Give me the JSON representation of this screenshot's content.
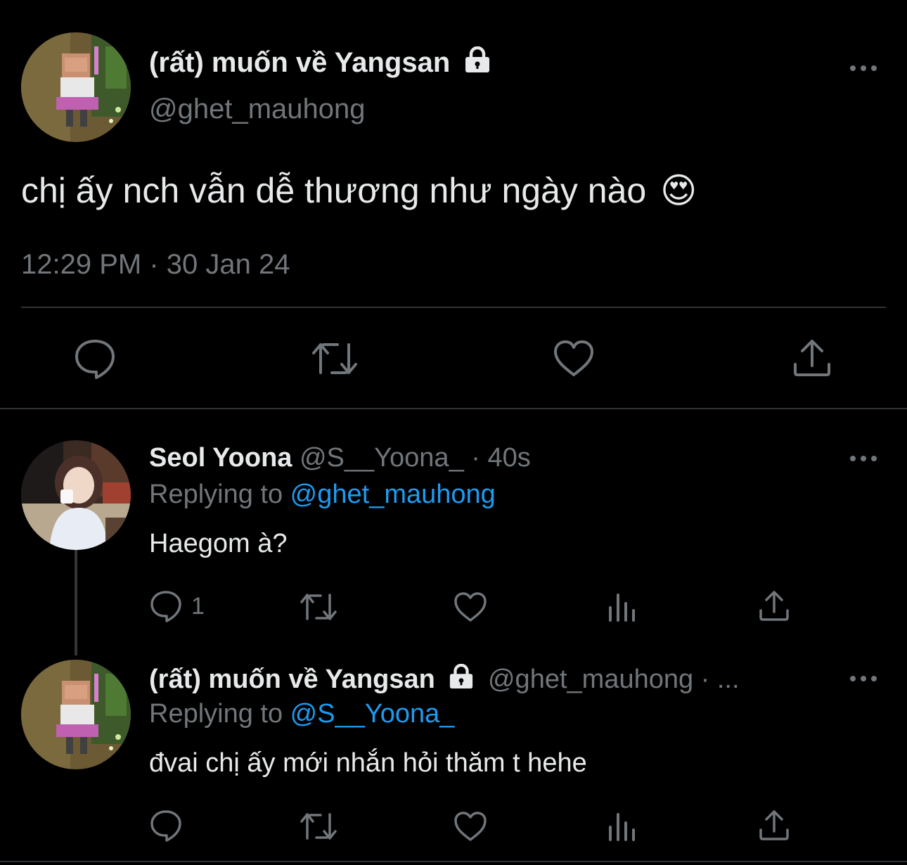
{
  "main_tweet": {
    "display_name": "(rất) muốn về Yangsan",
    "handle": "@ghet_mauhong",
    "text": "chị ấy nch vẫn dễ thương như ngày nào",
    "emoji": "😍",
    "timestamp": "12:29 PM · 30 Jan 24",
    "avatar": "pixel-character-avatar",
    "locked_icon": "lock-icon",
    "actions": [
      "reply-icon",
      "retweet-icon",
      "like-icon",
      "share-icon"
    ]
  },
  "replies": [
    {
      "display_name": "Seol Yoona",
      "handle_time": "@S__Yoona_ · 40s",
      "replying_prefix": "Replying to ",
      "replying_to": "@ghet_mauhong",
      "text": "Haegom à?",
      "reply_count": "1",
      "avatar": "photo-avatar"
    },
    {
      "display_name": "(rất) muốn về Yangsan",
      "handle_time": "@ghet_mauhong · ...",
      "replying_prefix": "Replying to ",
      "replying_to": "@S__Yoona_",
      "text": "đvai chị ấy mới nhắn hỏi thăm t hehe",
      "reply_count": "",
      "avatar": "pixel-character-avatar"
    }
  ],
  "colors": {
    "background": "#000000",
    "text": "#e7e9ea",
    "muted": "#71767b",
    "link": "#1d9bf0",
    "divider": "#2f3336"
  }
}
